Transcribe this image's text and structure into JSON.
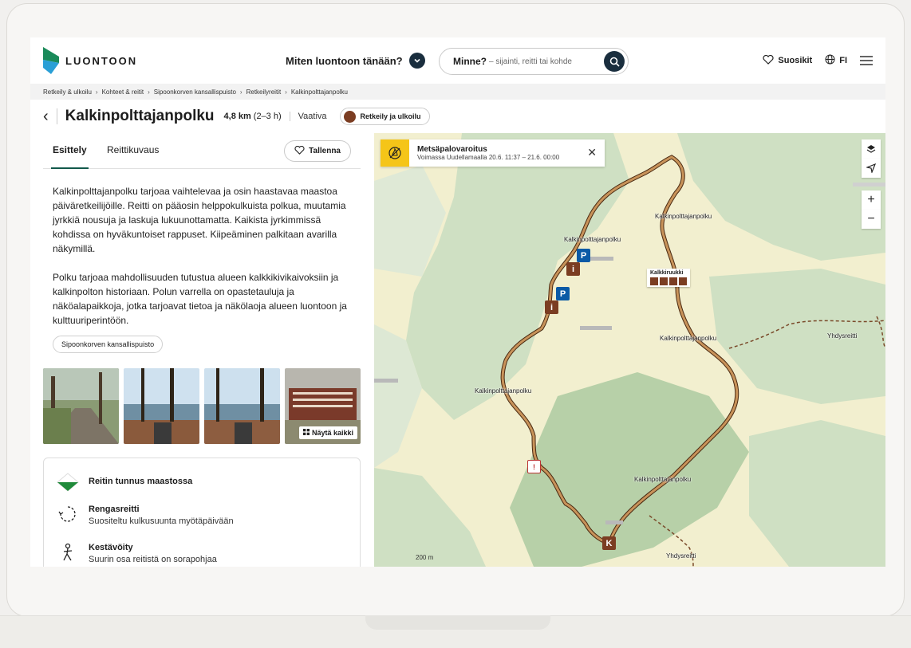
{
  "header": {
    "logo_text": "LUONTOON",
    "mood_label": "Miten luontoon tänään?",
    "search_label": "Minne?",
    "search_placeholder": "– sijainti, reitti tai kohde",
    "favorites_label": "Suosikit",
    "language_label": "FI"
  },
  "breadcrumb": [
    "Retkeily & ulkoilu",
    "Kohteet & reitit",
    "Sipoonkorven kansallispuisto",
    "Retkeilyreitit",
    "Kalkinpolttajanpolku"
  ],
  "route": {
    "title": "Kalkinpolttajanpolku",
    "distance": "4,8 km",
    "duration": "(2–3 h)",
    "difficulty": "Vaativa",
    "category": "Retkeily ja ulkoilu"
  },
  "tabs": [
    "Esittely",
    "Reittikuvaus"
  ],
  "save_label": "Tallenna",
  "description": [
    "Kalkinpolttajanpolku tarjoaa vaihtelevaa ja osin haastavaa maastoa päiväretkeilijöille. Reitti on pääosin helppokulkuista polkua, muutamia jyrkkiä nousuja ja laskuja lukuunottamatta. Kaikista jyrkimmissä kohdissa on hyväkuntoiset rappuset. Kiipeäminen palkitaan avarilla näkymillä.",
    "Polku tarjoaa mahdollisuuden tutustua alueen kalkkikivikaivoksiin ja kalkinpolton historiaan. Polun varrella on opastetauluja ja näköalapaikkoja, jotka tarjoavat tietoa ja näkölaoja alueen luontoon ja kulttuuriperintöön."
  ],
  "park_chip": "Sipoonkorven kansallispuisto",
  "gallery": {
    "show_all_label": "Näytä kaikki"
  },
  "info": {
    "marker_title": "Reitin tunnus maastossa",
    "loop_title": "Rengasreitti",
    "loop_sub": "Suositeltu kulkusuunta myötäpäivään",
    "surface_title": "Kestävöity",
    "surface_sub": "Suurin osa reitistä on sorapohjaa"
  },
  "map": {
    "warning_title": "Metsäpalovaroitus",
    "warning_sub": "Voimassa  Uudellamaalla 20.6. 11:37 – 21.6. 00:00",
    "labels": [
      "Kalkinpolttajanpolku",
      "Kalkinpolttajanpolku",
      "Kalkinpolttajanpolku",
      "Kalkinpolttajanpolku",
      "Kalkinpolttajanpolku"
    ],
    "poi_name": "Kalkkiruukki",
    "trail_yhdys_1": "Yhdysreitti",
    "trail_yhdys_2": "Yhdysreitti",
    "scale": "200 m",
    "marker_p": "P",
    "marker_i": "i",
    "zoom_in": "+",
    "zoom_out": "−",
    "route_color": "#9c6b3c"
  }
}
